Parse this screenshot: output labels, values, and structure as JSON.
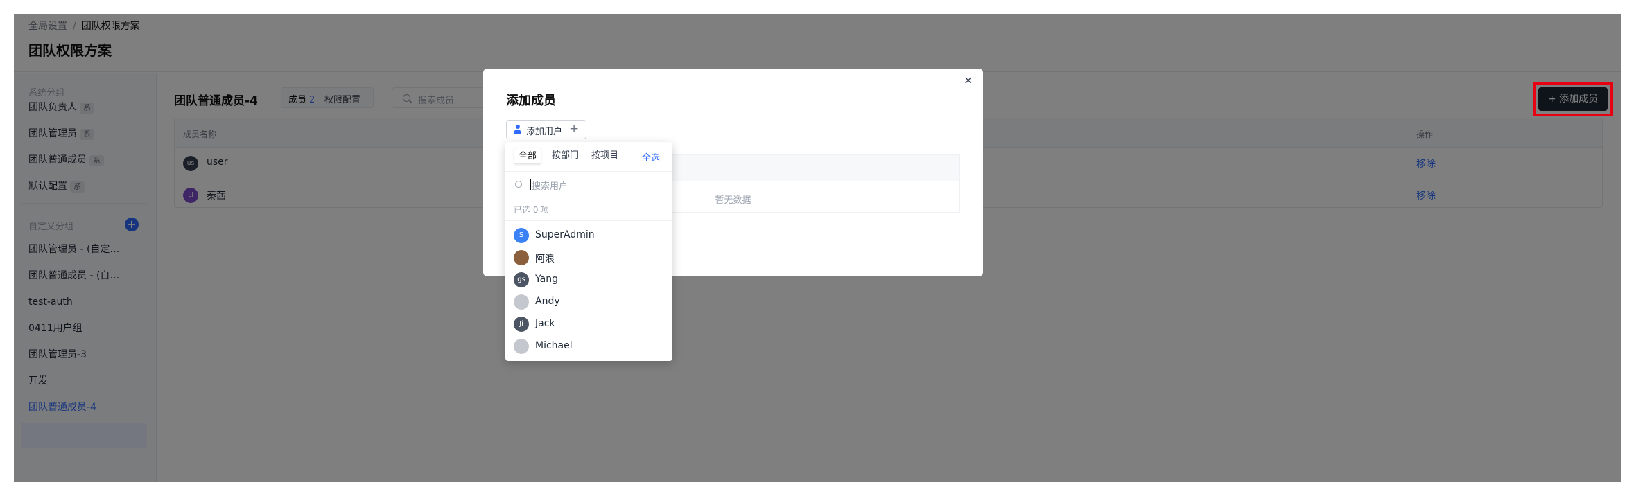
{
  "breadcrumb": {
    "parent": "全局设置",
    "separator": "/",
    "current": "团队权限方案"
  },
  "page_title": "团队权限方案",
  "sidebar": {
    "system_group_label": "系统分组",
    "system_items": [
      {
        "label": "团队负责人",
        "tag": "系"
      },
      {
        "label": "团队管理员",
        "tag": "系"
      },
      {
        "label": "团队普通成员",
        "tag": "系"
      },
      {
        "label": "默认配置",
        "tag": "系"
      }
    ],
    "custom_group_label": "自定义分组",
    "add_group_icon": "+",
    "custom_items": [
      {
        "label": "团队管理员 - (自定…"
      },
      {
        "label": "团队普通成员 - (自…"
      },
      {
        "label": "test-auth"
      },
      {
        "label": "0411用户组"
      },
      {
        "label": "团队管理员-3"
      },
      {
        "label": "开发"
      },
      {
        "label": "团队普通成员-4"
      }
    ]
  },
  "main": {
    "title": "团队普通成员-4",
    "tabs": [
      {
        "label": "成员",
        "count": "2"
      },
      {
        "label": "权限配置"
      }
    ],
    "search_placeholder": "搜索成员",
    "add_member_label": "+ 添加成员",
    "table": {
      "headers": [
        "成员名称",
        "操作"
      ],
      "rows": [
        {
          "avatar_text": "us",
          "avatar_color": "#374151",
          "name": "user",
          "action": "移除"
        },
        {
          "avatar_text": "Li",
          "avatar_color": "#7c4dcc",
          "name": "秦茜",
          "action": "移除"
        }
      ]
    }
  },
  "modal": {
    "title": "添加成员",
    "close_icon": "×",
    "add_user_label": "添加用户",
    "add_user_plus": "+",
    "empty_text": "暂无数据"
  },
  "dropdown": {
    "tabs": [
      "全部",
      "按部门",
      "按项目"
    ],
    "select_all": "全选",
    "search_placeholder": "搜索用户",
    "selected_count": "已选 0 项",
    "users": [
      {
        "name": "SuperAdmin",
        "avatar_text": "S",
        "avatar_color": "#3b82f6"
      },
      {
        "name": "阿浪",
        "avatar_text": "",
        "avatar_color": "#8b5e3c"
      },
      {
        "name": "Yang",
        "avatar_text": "gs",
        "avatar_color": "#4b5563"
      },
      {
        "name": "Andy",
        "avatar_text": "",
        "avatar_color": "#c4c8ce"
      },
      {
        "name": "Jack",
        "avatar_text": "Ji",
        "avatar_color": "#4b5563"
      },
      {
        "name": "Michael",
        "avatar_text": "",
        "avatar_color": "#c4c8ce"
      }
    ]
  },
  "colors": {
    "accent": "#2f6bff",
    "highlight_box": "#e60012",
    "dark_button": "#1f2937"
  }
}
